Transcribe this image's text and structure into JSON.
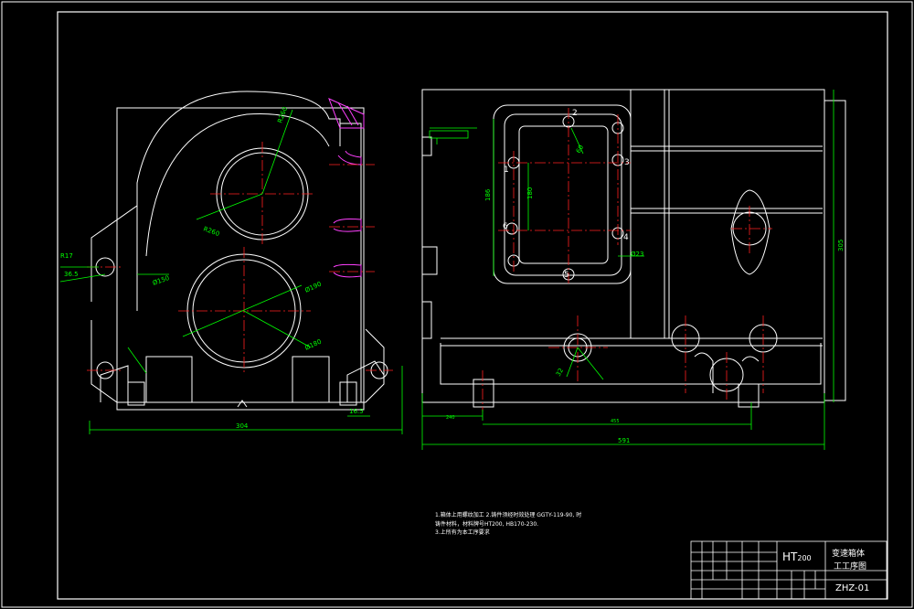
{
  "dims": {
    "left_width": "304",
    "right_width": "591",
    "right_height": "305",
    "hole_spacing": "186",
    "side_dim_left": "36.5",
    "side_dim_right": "16.5",
    "r_top": "R260",
    "r_mid": "R260",
    "dia_small": "Ø150",
    "dia_large": "Ø190",
    "dia_bore": "Ø180",
    "r_small": "R17",
    "dim_180": "180",
    "dim_60": "60",
    "dim_23": "Ø23",
    "dim_32": "32",
    "dim_bottom_a": "240",
    "dim_bottom_b": "455"
  },
  "labels": {
    "hole_1": "1",
    "hole_2": "2",
    "hole_3": "3",
    "hole_4": "4",
    "hole_5": "5",
    "hole_6": "6"
  },
  "notes": {
    "line1": "1.箱体上用螺纹加工 2.铸件须经时效处理  GGTY-119-90, 时",
    "line2": "铸件材料，材料牌号HT200, HB170-230.",
    "line3": "3.上所有为本工序要求"
  },
  "title_block": {
    "material": "HT",
    "material_grade": "200",
    "part_name_1": "变速箱体",
    "part_name_2": "工工序图",
    "drawing_no": "ZHZ-01"
  },
  "colors": {
    "outline": "#ffffff",
    "centerline": "#ff2020",
    "dimension": "#00ff00",
    "section": "#ff40ff"
  }
}
